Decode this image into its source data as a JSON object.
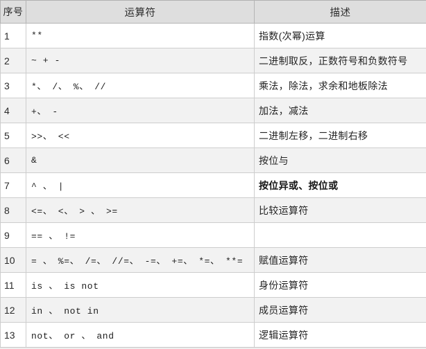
{
  "table": {
    "headers": {
      "index": "序号",
      "operator": "运算符",
      "description": "描述"
    },
    "rows": [
      {
        "index": "1",
        "operator": "**",
        "description": "指数(次幂)运算"
      },
      {
        "index": "2",
        "operator": "~ + -",
        "description": "二进制取反，正数符号和负数符号"
      },
      {
        "index": "3",
        "operator": "*、 /、 %、 //",
        "description": "乘法，除法，求余和地板除法"
      },
      {
        "index": "4",
        "operator": "+、 -",
        "description": "加法，减法"
      },
      {
        "index": "5",
        "operator": ">>、 <<",
        "description": "二进制左移，二进制右移"
      },
      {
        "index": "6",
        "operator": "&",
        "description": "按位与"
      },
      {
        "index": "7",
        "operator": "^ 、 |",
        "description": "按位异或、按位或",
        "bold": true
      },
      {
        "index": "8",
        "operator": "<=、 <、 > 、 >=",
        "description": "比较运算符"
      },
      {
        "index": "9",
        "operator": " == 、 !=",
        "description": ""
      },
      {
        "index": "10",
        "operator": "= 、 %=、 /=、 //=、 -=、 +=、 *=、 **=",
        "description": "赋值运算符"
      },
      {
        "index": "11",
        "operator": "is 、 is not",
        "description": "身份运算符"
      },
      {
        "index": "12",
        "operator": "in 、 not in",
        "description": "成员运算符"
      },
      {
        "index": "13",
        "operator": "not、 or 、 and",
        "description": "逻辑运算符"
      }
    ]
  },
  "colors": {
    "header_bg": "#dedede",
    "row_alt_bg": "#f2f2f2",
    "row_bg": "#ffffff",
    "border": "#cdcdcd",
    "text": "#202020"
  }
}
